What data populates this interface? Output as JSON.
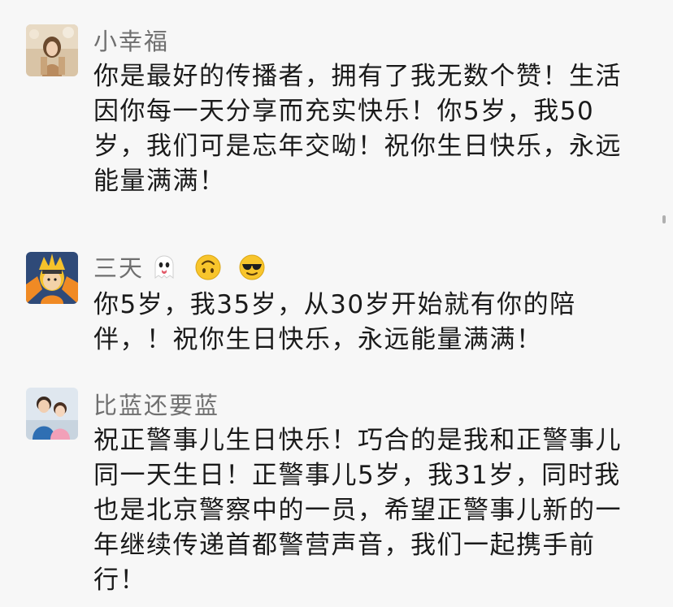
{
  "comments": [
    {
      "name": "小幸福",
      "text": "你是最好的传播者，拥有了我无数个赞！生活因你每一天分享而充实快乐！你5岁，我50岁，我们可是忘年交呦！祝你生日快乐，永远能量满满！",
      "avatar_icon": "woman-photo-avatar"
    },
    {
      "name": "三天",
      "name_emojis": [
        "ghost-emoji",
        "upside-down-face-emoji",
        "sunglasses-face-emoji"
      ],
      "text": "你5岁，我35岁，从30岁开始就有你的陪伴，！祝你生日快乐，永远能量满满！",
      "avatar_icon": "anime-character-avatar"
    },
    {
      "name": "比蓝还要蓝",
      "text": "祝正警事儿生日快乐！巧合的是我和正警事儿同一天生日！正警事儿5岁，我31岁，同时我也是北京警察中的一员，希望正警事儿新的一年继续传递首都警营声音，我们一起携手前行！",
      "avatar_icon": "family-photo-avatar"
    }
  ]
}
